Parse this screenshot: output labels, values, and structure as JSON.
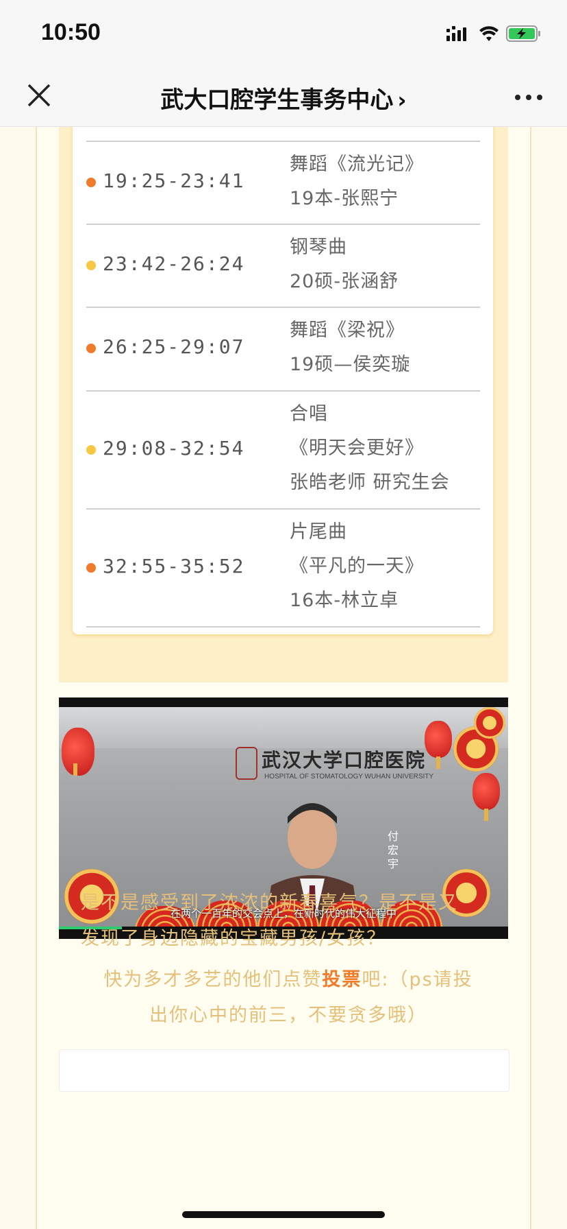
{
  "status": {
    "time": "10:50"
  },
  "nav": {
    "title": "武大口腔学生事务中心",
    "chevron": "›"
  },
  "colors": {
    "orange_dot": "#ef7c2a",
    "yellow_dot": "#f7c744",
    "text_gold": "#e5c07a",
    "vote_orange": "#ef7c2a"
  },
  "schedule": [
    {
      "time": "19:25-23:41",
      "dot": "orange",
      "lines": [
        "舞蹈《流光记》",
        "19本-张熙宁"
      ]
    },
    {
      "time": "23:42-26:24",
      "dot": "yellow",
      "lines": [
        "钢琴曲",
        "20硕-张涵舒"
      ]
    },
    {
      "time": "26:25-29:07",
      "dot": "orange",
      "lines": [
        "舞蹈《梁祝》",
        "19硕—侯奕璇"
      ]
    },
    {
      "time": "29:08-32:54",
      "dot": "yellow",
      "lines": [
        "合唱",
        "《明天会更好》",
        "张皓老师 研究生会"
      ]
    },
    {
      "time": "32:55-35:52",
      "dot": "orange",
      "lines": [
        "片尾曲",
        "《平凡的一天》",
        "16本-林立卓"
      ]
    }
  ],
  "video": {
    "sign_main": "武汉大学口腔医院",
    "sign_sub": "HOSPITAL OF STOMATOLOGY WUHAN UNIVERSITY",
    "speaker_name": "付宏宇",
    "caption": "在两个一百年的交会点上，在新时代的伟大征程中",
    "progress": 0.14
  },
  "text": {
    "para1_line1": "是不是感受到了浓浓的新春喜气？是不是又",
    "para1_line2": "发现了身边隐藏的宝藏男孩/女孩？",
    "para2_before": "快为多才多艺的他们点赞",
    "para2_vote": "投票",
    "para2_after": "吧:（ps请投",
    "para2_line2": "出你心中的前三，不要贪多哦）"
  }
}
